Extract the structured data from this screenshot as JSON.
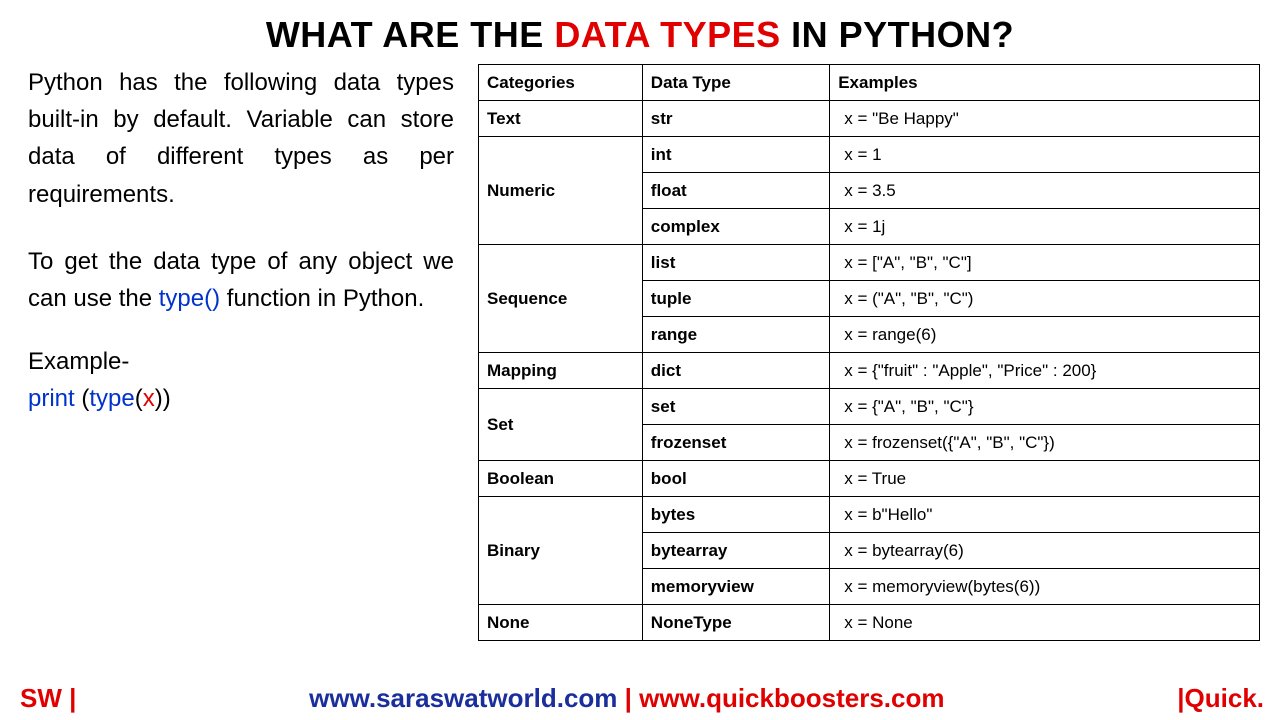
{
  "title": {
    "pre": "WHAT ARE THE ",
    "highlight": "DATA TYPES",
    "post": " IN PYTHON?"
  },
  "left": {
    "para1": "Python has the following data types built-in by default. Variable can store data of different types as per requirements.",
    "para2_a": "To get the data type of any object we can use the ",
    "para2_type": "type()",
    "para2_b": " function in Python.",
    "example_label": "Example-",
    "code_print": "print ",
    "code_paren1": "(",
    "code_type": "type",
    "code_paren2": "(",
    "code_var": "x",
    "code_paren3": "))"
  },
  "table": {
    "headers": [
      "Categories",
      "Data Type",
      "Examples"
    ],
    "groups": [
      {
        "category": "Text",
        "rows": [
          {
            "type": "str",
            "example": "x = \"Be Happy\""
          }
        ]
      },
      {
        "category": "Numeric",
        "rows": [
          {
            "type": "int",
            "example": "x = 1"
          },
          {
            "type": "float",
            "example": "x = 3.5"
          },
          {
            "type": "complex",
            "example": "x = 1j"
          }
        ]
      },
      {
        "category": "Sequence",
        "rows": [
          {
            "type": "list",
            "example": "x = [\"A\", \"B\", \"C\"]"
          },
          {
            "type": "tuple",
            "example": "x = (\"A\", \"B\", \"C\")"
          },
          {
            "type": "range",
            "example": "x = range(6)"
          }
        ]
      },
      {
        "category": "Mapping",
        "rows": [
          {
            "type": "dict",
            "example": "x = {\"fruit\" : \"Apple\", \"Price\" : 200}"
          }
        ]
      },
      {
        "category": "Set",
        "rows": [
          {
            "type": "set",
            "example": "x = {\"A\", \"B\", \"C\"}"
          },
          {
            "type": "frozenset",
            "example": "x = frozenset({\"A\",  \"B\", \"C\"})"
          }
        ]
      },
      {
        "category": "Boolean",
        "rows": [
          {
            "type": "bool",
            "example": "x = True"
          }
        ]
      },
      {
        "category": "Binary",
        "rows": [
          {
            "type": "bytes",
            "example": "x = b\"Hello\""
          },
          {
            "type": "bytearray",
            "example": "x = bytearray(6)"
          },
          {
            "type": "memoryview",
            "example": "x = memoryview(bytes(6))"
          }
        ]
      },
      {
        "category": "None",
        "rows": [
          {
            "type": "NoneType",
            "example": "x = None"
          }
        ]
      }
    ]
  },
  "footer": {
    "left": "SW |",
    "link1": "www.saraswatworld.com",
    "sep": " | ",
    "link2": "www.quickboosters.com",
    "right": "|Quick."
  }
}
